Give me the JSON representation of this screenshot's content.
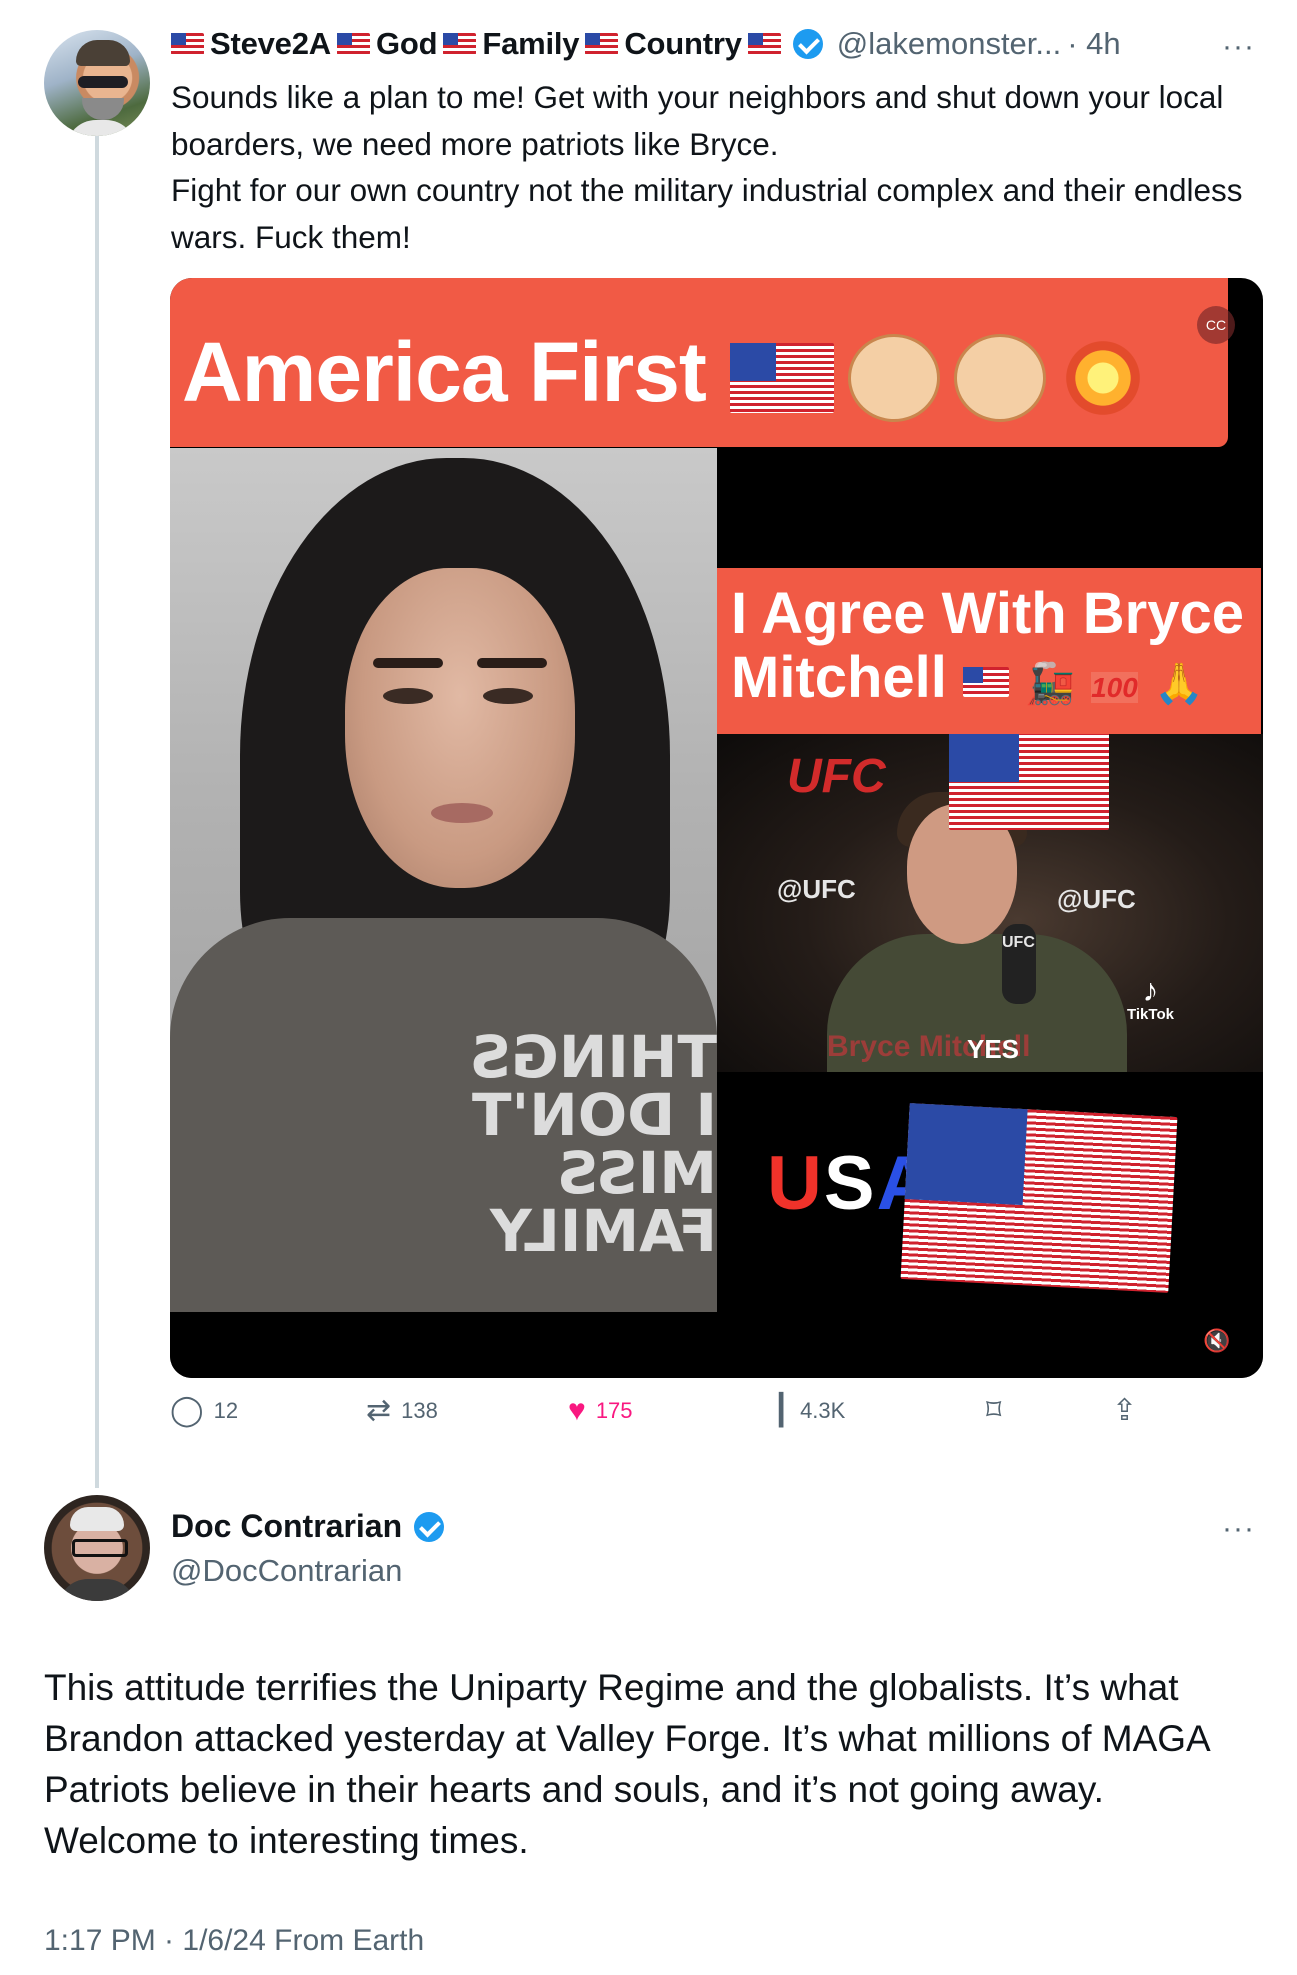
{
  "reply_tweet": {
    "author_name_parts": [
      "Steve2A",
      "God",
      "Family",
      "Country"
    ],
    "handle": "@lakemonster...",
    "dot_time": "· 4h",
    "more": "···",
    "body": [
      "Sounds like a plan to me! Get with your neighbors and shut down your local boarders, we need more patriots like Bryce.",
      "Fight for our own country not the military industrial complex and their endless wars. Fuck them!"
    ],
    "media": {
      "banner": "America First",
      "right_label": "I Agree With Bryce Mitchell",
      "ufc_logo": "UFC",
      "ufc_handle_left": "@UFC",
      "ufc_handle_right": "@UFC",
      "mic_label": "UFC",
      "lower_third": "Bryce Mitchell",
      "yes": "YES",
      "tiktok": "TikTok",
      "usa": {
        "u": "U",
        "s": "S",
        "a": "A"
      },
      "shirt": "THINGS\nI DON'T MISS\nFAMILY",
      "badge_100": "100"
    },
    "actions": {
      "replies": "12",
      "reposts": "138",
      "likes": "175",
      "views": "4.3K"
    }
  },
  "main_tweet": {
    "author_name": "Doc Contrarian",
    "handle": "@DocContrarian",
    "more": "···",
    "body": "This attitude terrifies the Uniparty Regime and the globalists. It’s what Brandon attacked yesterday at Valley Forge. It’s what millions of MAGA Patriots believe in their hearts and souls, and it’s not going away. Welcome to interesting times.",
    "meta": "1:17 PM · 1/6/24 From Earth"
  },
  "icons": [
    "flag-icon",
    "verified-badge-icon",
    "more-icon",
    "reply-icon",
    "repost-icon",
    "like-icon",
    "views-icon",
    "bookmark-icon",
    "share-icon",
    "mute-icon",
    "captions-icon"
  ],
  "colors": {
    "accent": "#1d9bf0",
    "like": "#f91880",
    "muted_text": "#536471",
    "banner": "#f15a45",
    "thread_line": "#cfd9de"
  }
}
